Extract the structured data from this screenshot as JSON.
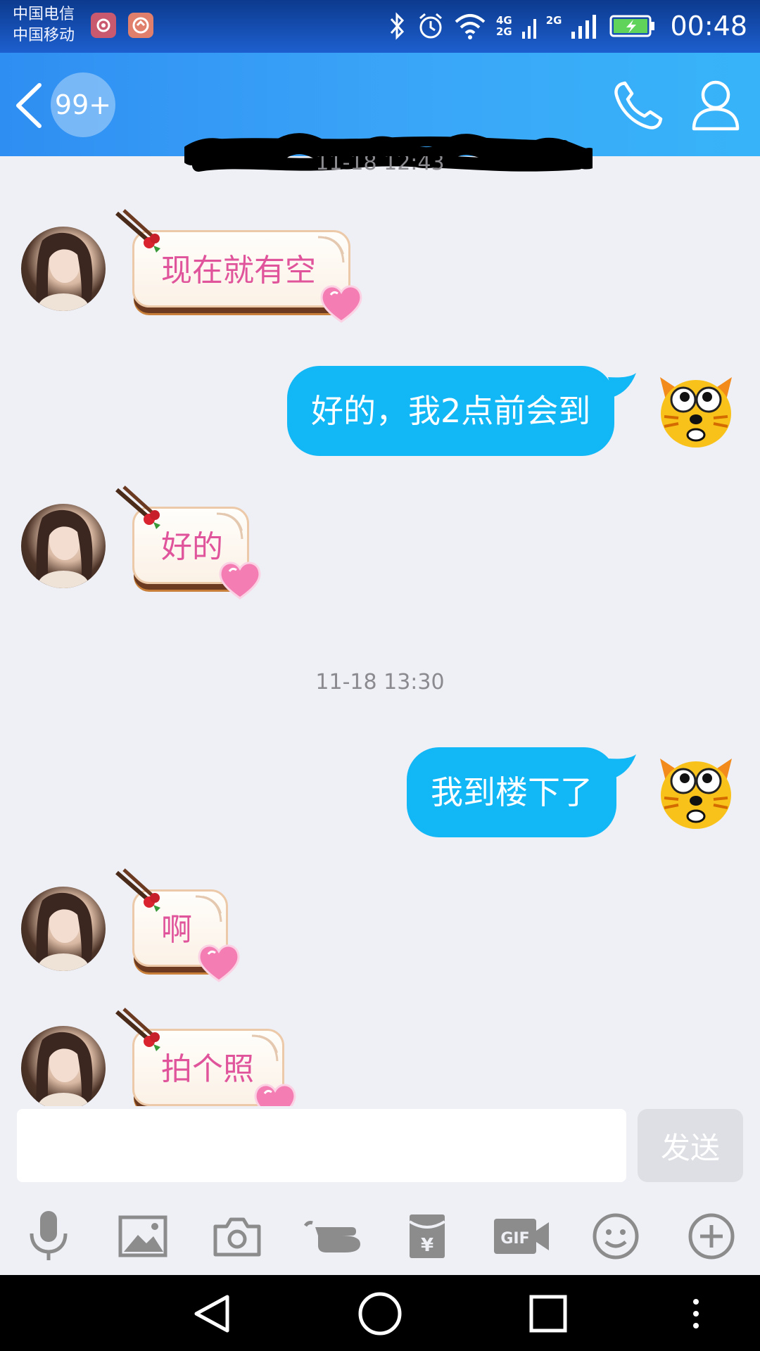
{
  "status_bar": {
    "carrier_1": "中国电信",
    "carrier_2": "中国移动",
    "network_1": "4G",
    "network_2": "2G",
    "network_3": "2G",
    "time": "00:48",
    "icons": [
      "huawei-app-icon",
      "app-notification-icon",
      "bluetooth-icon",
      "alarm-icon",
      "wifi-icon",
      "signal-icon",
      "battery-charging-icon"
    ]
  },
  "header": {
    "unread_badge": "99+",
    "title": "",
    "icons": [
      "back-icon",
      "phone-icon",
      "profile-icon"
    ]
  },
  "messages": [
    {
      "type": "timestamp",
      "text": "11-18 12:43"
    },
    {
      "type": "received",
      "text": "现在就有空"
    },
    {
      "type": "sent",
      "text": "好的，我2点前会到"
    },
    {
      "type": "received",
      "text": "好的"
    },
    {
      "type": "timestamp",
      "text": "11-18 13:30"
    },
    {
      "type": "sent",
      "text": "我到楼下了"
    },
    {
      "type": "received",
      "text": "啊"
    },
    {
      "type": "received",
      "text": "拍个照"
    }
  ],
  "composer": {
    "input_value": "",
    "send_label": "发送"
  },
  "toolbar": {
    "gif_label": "GIF",
    "icons": [
      "microphone-icon",
      "image-icon",
      "camera-icon",
      "poke-icon",
      "red-packet-icon",
      "gif-icon",
      "emoji-icon",
      "plus-icon"
    ]
  },
  "navigation": {
    "icons": [
      "back-triangle-icon",
      "home-circle-icon",
      "recents-square-icon",
      "more-dots-icon"
    ]
  },
  "colors": {
    "header_start": "#2f8ef2",
    "header_end": "#37b4f9",
    "sent_bubble": "#12b7f5",
    "received_text": "#e0549c",
    "background": "#eef0f6"
  }
}
